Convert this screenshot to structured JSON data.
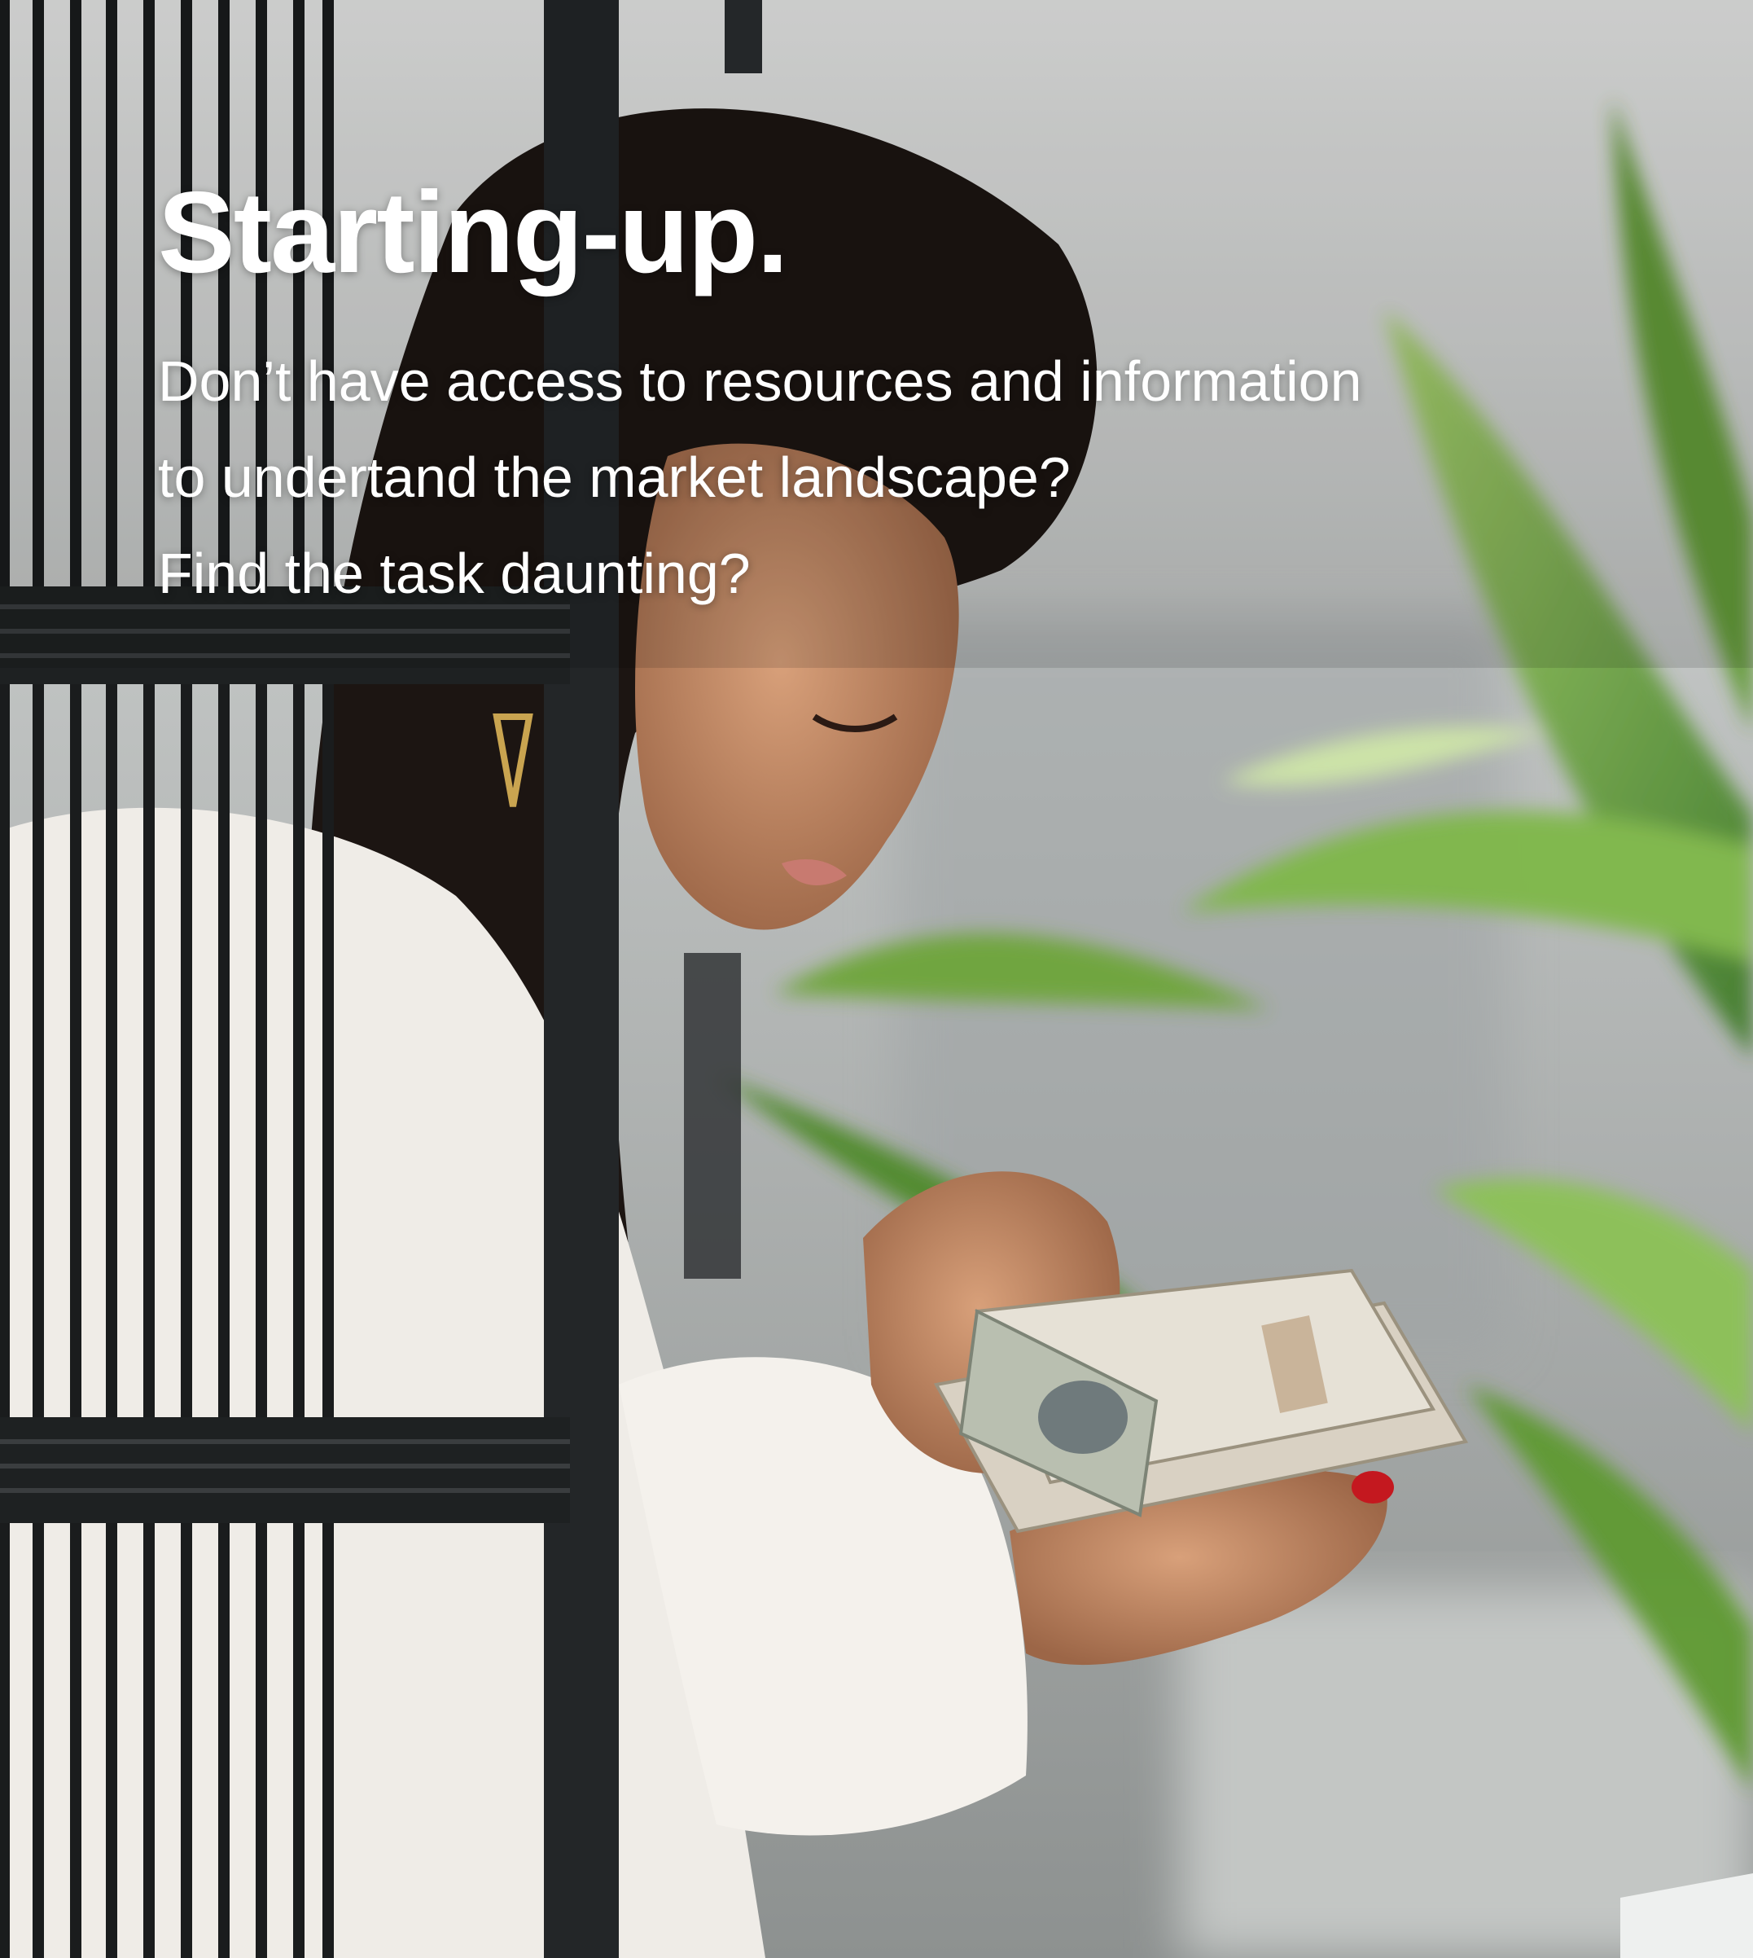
{
  "hero": {
    "title": "Starting-up.",
    "lines": [
      "Don’t have access to resources and information",
      "to undertand the market landscape?",
      "Find the task daunting?"
    ]
  },
  "photo": {
    "subject": "woman counting banknotes",
    "accent_colors": [
      "#f2efe9",
      "#1f2224",
      "#6f9e3a",
      "#c8cac6"
    ]
  }
}
